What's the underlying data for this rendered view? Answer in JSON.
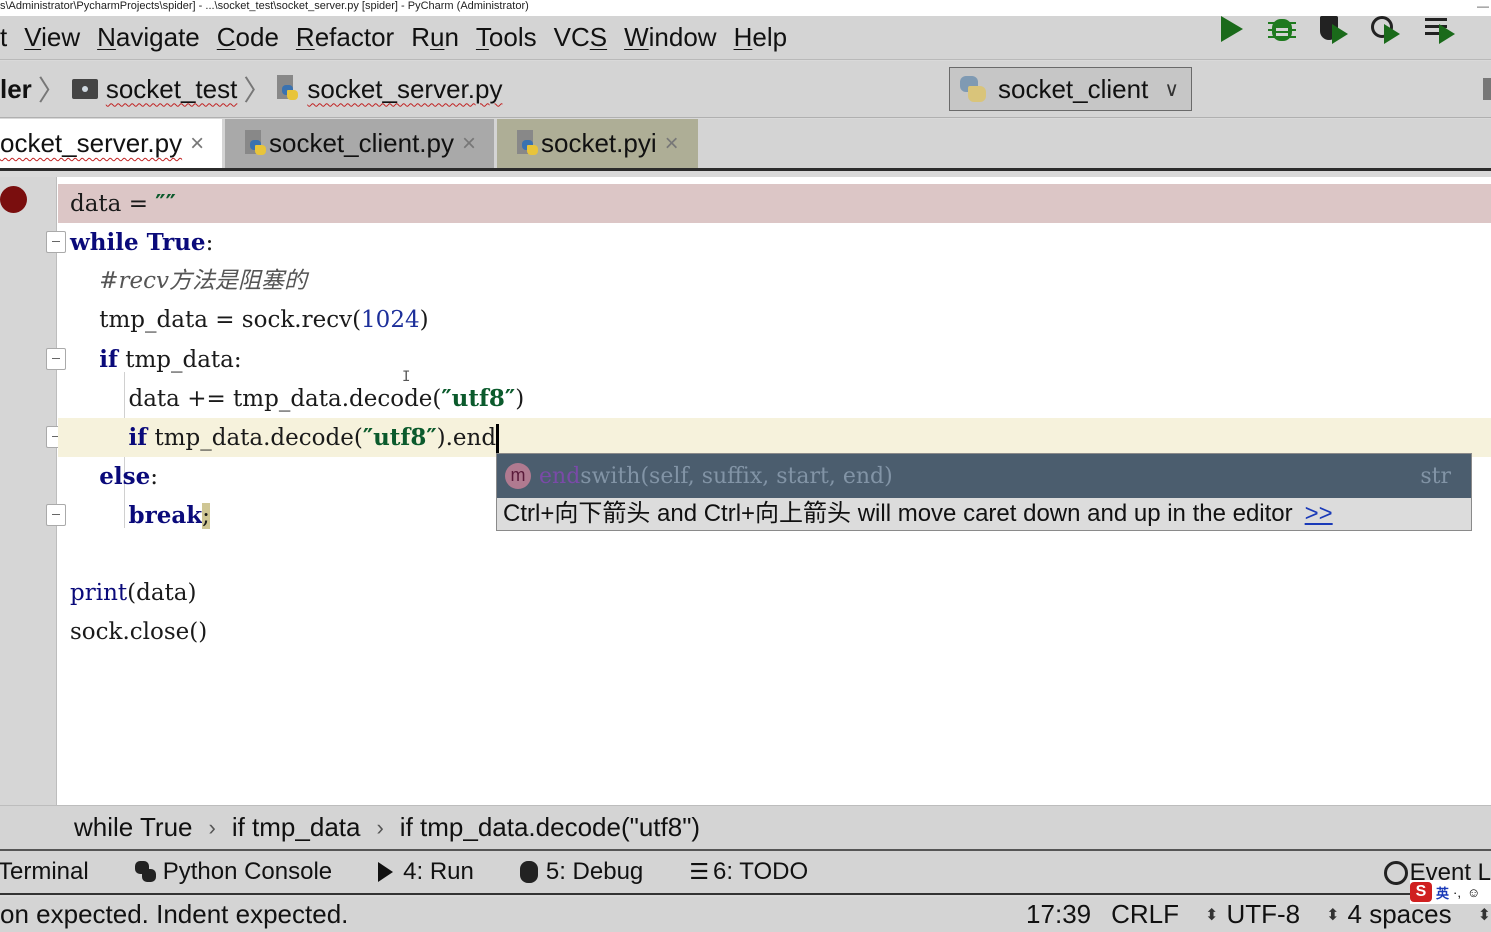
{
  "window": {
    "title": "s\\Administrator\\PycharmProjects\\spider] - ...\\socket_test\\socket_server.py [spider] - PyCharm (Administrator)"
  },
  "menu": {
    "items": [
      {
        "label": "t",
        "mnemonic": ""
      },
      {
        "label": "View",
        "mnemonic": "V"
      },
      {
        "label": "Navigate",
        "mnemonic": "N"
      },
      {
        "label": "Code",
        "mnemonic": "C"
      },
      {
        "label": "Refactor",
        "mnemonic": "R"
      },
      {
        "label": "Run",
        "mnemonic": "u"
      },
      {
        "label": "Tools",
        "mnemonic": "T"
      },
      {
        "label": "VCS",
        "mnemonic": "S"
      },
      {
        "label": "Window",
        "mnemonic": "W"
      },
      {
        "label": "Help",
        "mnemonic": "H"
      }
    ]
  },
  "navbar": {
    "breadcrumbs": [
      "ler",
      "socket_test",
      "socket_server.py"
    ],
    "run_config": "socket_client",
    "toolbar_icons": [
      "run-icon",
      "debug-icon",
      "run-with-coverage-icon",
      "profile-icon",
      "concurrency-diagram-icon",
      "stop-icon"
    ]
  },
  "tabs": [
    {
      "label": "ocket_server.py",
      "active": true
    },
    {
      "label": "socket_client.py",
      "active": false
    },
    {
      "label": "socket.pyi",
      "active": false
    }
  ],
  "editor": {
    "lines": [
      {
        "text": "data = \"\"",
        "breakpoint": true
      },
      {
        "text": "while True:",
        "fold": true
      },
      {
        "text": "    #recv方法是阻塞的"
      },
      {
        "text": "    tmp_data = sock.recv(1024)"
      },
      {
        "text": "    if tmp_data:",
        "fold": true
      },
      {
        "text": "        data += tmp_data.decode(\"utf8\")"
      },
      {
        "text": "        if tmp_data.decode(\"utf8\").end",
        "current": true,
        "fold": true
      },
      {
        "text": "    else:"
      },
      {
        "text": "        break;",
        "fold": true
      },
      {
        "text": ""
      },
      {
        "text": "print(data)"
      },
      {
        "text": "sock.close()"
      }
    ],
    "completion": {
      "kind_icon": "m",
      "matched": "end",
      "rest": "swith(self, suffix, start, end)",
      "return_type": "str",
      "hint": "Ctrl+向下箭头 and Ctrl+向上箭头 will move caret down and up in the editor",
      "hint_link": ">>"
    }
  },
  "structure_breadcrumb": [
    "while True",
    "if tmp_data",
    "if tmp_data.decode(\"utf8\")"
  ],
  "tool_windows": [
    {
      "label": "Terminal",
      "icon": ""
    },
    {
      "label": "Python Console",
      "icon": "python-console-icon"
    },
    {
      "label": "4: Run",
      "icon": "run-icon"
    },
    {
      "label": "5: Debug",
      "icon": "debug-icon"
    },
    {
      "label": "6: TODO",
      "icon": "todo-icon"
    },
    {
      "label": "Event L",
      "icon": "event-log-icon"
    }
  ],
  "status": {
    "message": "on expected. Indent expected.",
    "position": "17:39",
    "line_separator": "CRLF",
    "encoding": "UTF-8",
    "indent": "4 spaces"
  },
  "ime": {
    "logo": "S",
    "mode": "英"
  }
}
